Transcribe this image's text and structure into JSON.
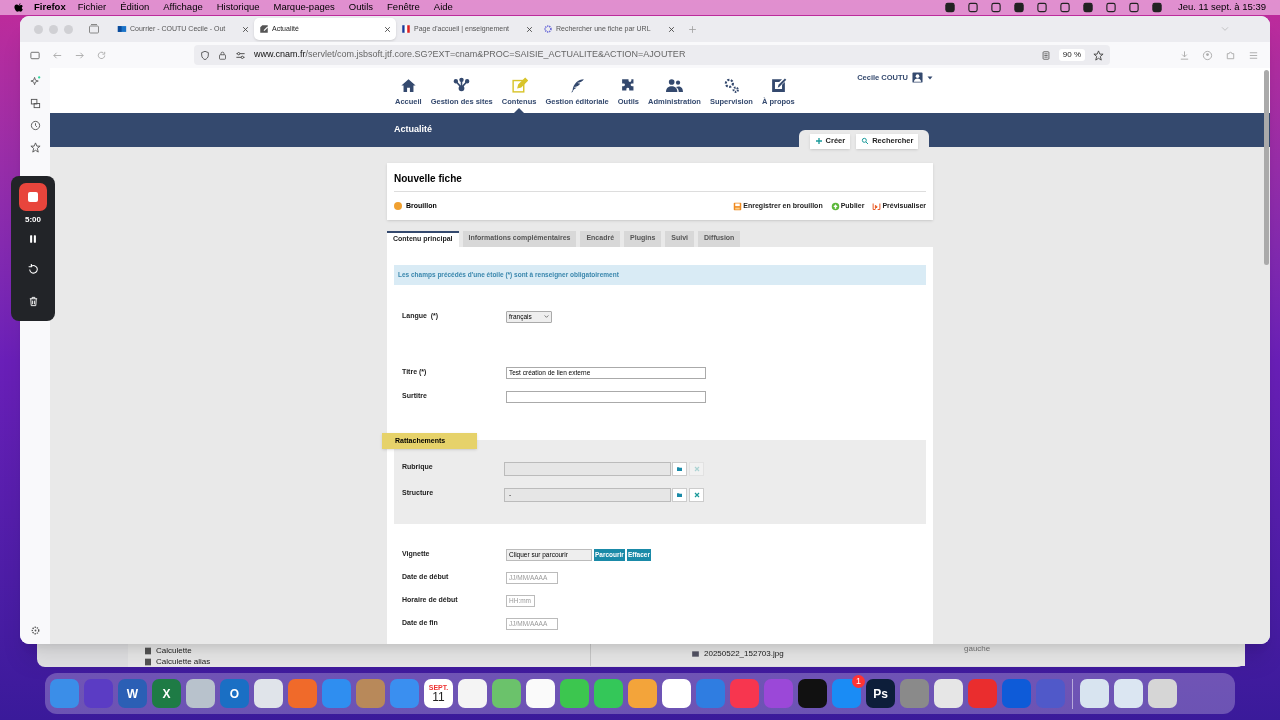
{
  "menu_bar": {
    "app": "Firefox",
    "menus": [
      "Fichier",
      "Édition",
      "Affichage",
      "Historique",
      "Marque-pages",
      "Outils",
      "Fenêtre",
      "Aide"
    ],
    "clock": "Jeu. 11 sept. à 15:39"
  },
  "tabs": [
    {
      "label": "Courrier - COUTU Cecile - Out",
      "selected": false,
      "kind": "mail"
    },
    {
      "label": "Actualité",
      "selected": true,
      "kind": "edit"
    },
    {
      "label": "Page d'accueil | enseignement",
      "selected": false,
      "kind": "flag"
    },
    {
      "label": "Rechercher une fiche par URL",
      "selected": false,
      "kind": "gear"
    }
  ],
  "address_bar": {
    "host": "www.cnam.fr",
    "path": "/servlet/com.jsbsoft.jtf.core.SG?EXT=cnam&PROC=SAISIE_ACTUALITE&ACTION=AJOUTER",
    "zoom": "90 %"
  },
  "recorder": {
    "time": "5:00"
  },
  "site_nav": {
    "items": [
      {
        "label": "Accueil",
        "kind": "home",
        "selected": false
      },
      {
        "label": "Gestion des sites",
        "kind": "network",
        "selected": false
      },
      {
        "label": "Contenus",
        "kind": "edit",
        "selected": true
      },
      {
        "label": "Gestion éditoriale",
        "kind": "feather",
        "selected": false
      },
      {
        "label": "Outils",
        "kind": "puzzle",
        "selected": false
      },
      {
        "label": "Administration",
        "kind": "users",
        "selected": false
      },
      {
        "label": "Supervision",
        "kind": "gears",
        "selected": false
      },
      {
        "label": "À propos",
        "kind": "about",
        "selected": false
      }
    ],
    "user": "Cecile COUTU"
  },
  "page_title": "Actualité",
  "page_actions": [
    {
      "label": "Créer",
      "kind": "plus"
    },
    {
      "label": "Rechercher",
      "kind": "search"
    }
  ],
  "card": {
    "title": "Nouvelle fiche",
    "status": {
      "label": "Brouillon",
      "color": "#f0a030"
    },
    "actions": [
      {
        "label": "Enregistrer en brouillon",
        "kind": "save"
      },
      {
        "label": "Publier",
        "kind": "publish"
      },
      {
        "label": "Prévisualiser",
        "kind": "preview"
      }
    ]
  },
  "form_tabs": [
    {
      "label": "Contenu principal",
      "selected": true
    },
    {
      "label": "Informations complémentaires",
      "selected": false
    },
    {
      "label": "Encadré",
      "selected": false
    },
    {
      "label": "Plugins",
      "selected": false
    },
    {
      "label": "Suivi",
      "selected": false
    },
    {
      "label": "Diffusion",
      "selected": false
    }
  ],
  "notice": "Les champs précédés d'une étoile (*) sont à renseigner obligatoirement",
  "fields": [
    {
      "label": "Langue  (*)",
      "kind": "select",
      "value": "français"
    },
    {
      "label": "Titre (*)",
      "kind": "text",
      "value": "Test création de lien externe"
    },
    {
      "label": "Surtitre",
      "kind": "text"
    }
  ],
  "rattachements": {
    "title": "Rattachements",
    "fields": [
      {
        "label": "Rubrique",
        "clear_enabled": false
      },
      {
        "label": "Structure",
        "value": "-",
        "clear_enabled": true
      }
    ]
  },
  "more_fields": [
    {
      "label": "Vignette",
      "kind": "file",
      "value": "Cliquer sur parcourir",
      "buttons": [
        "Parcourir",
        "Effacer"
      ]
    },
    {
      "label": "Date de début",
      "kind": "text",
      "placeholder": "JJ/MM/AAAA"
    },
    {
      "label": "Horaire de début",
      "kind": "short",
      "placeholder": "HH:mm"
    },
    {
      "label": "Date de fin",
      "kind": "text",
      "placeholder": "JJ/MM/AAAA"
    }
  ],
  "background_windows": {
    "finder_items": [
      "Calculette",
      "Calculette alias"
    ],
    "file": "20250522_152703.jpg",
    "column_text": "gauche"
  },
  "dock": [
    {
      "kind": "plain",
      "color": "#3b8ee8"
    },
    {
      "kind": "plain",
      "color": "#5b3cc4"
    },
    {
      "kind": "letter",
      "color": "#2b5fb5",
      "glyph": "W"
    },
    {
      "kind": "letter",
      "color": "#1e7b45",
      "glyph": "X"
    },
    {
      "kind": "plain",
      "color": "#b8c2cc"
    },
    {
      "kind": "letter",
      "color": "#1a6fc4",
      "glyph": "O"
    },
    {
      "kind": "plain",
      "color": "#e0e4ea"
    },
    {
      "kind": "plain",
      "color": "#f06a2a"
    },
    {
      "kind": "plain",
      "color": "#2f8ef0"
    },
    {
      "kind": "plain",
      "color": "#b8895a"
    },
    {
      "kind": "plain",
      "color": "#3a8ff0"
    },
    {
      "kind": "calendar",
      "color": "#ffffff",
      "month": "SEPT.",
      "day": "11"
    },
    {
      "kind": "plain",
      "color": "#f4f4f4"
    },
    {
      "kind": "plain",
      "color": "#6bc26b"
    },
    {
      "kind": "plain",
      "color": "#fafafa"
    },
    {
      "kind": "plain",
      "color": "#3cc64f"
    },
    {
      "kind": "plain",
      "color": "#34c759"
    },
    {
      "kind": "plain",
      "color": "#f3a43a"
    },
    {
      "kind": "plain",
      "color": "#ffffff"
    },
    {
      "kind": "plain",
      "color": "#2f7de1"
    },
    {
      "kind": "plain",
      "color": "#f7364f"
    },
    {
      "kind": "plain",
      "color": "#9b48d8"
    },
    {
      "kind": "plain",
      "color": "#111111"
    },
    {
      "kind": "badge",
      "color": "#1a8cf5",
      "badge": "1"
    },
    {
      "kind": "letter",
      "color": "#0d1e3a",
      "glyph": "Ps"
    },
    {
      "kind": "plain",
      "color": "#8a8a8a"
    },
    {
      "kind": "plain",
      "color": "#e6e6e6"
    },
    {
      "kind": "plain",
      "color": "#ea2d2e"
    },
    {
      "kind": "plain",
      "color": "#0e5bd8"
    },
    {
      "kind": "plain",
      "color": "#5059c9"
    },
    {
      "kind": "plain",
      "color": "#d8e4f0"
    },
    {
      "kind": "plain",
      "color": "#dbe6f2"
    },
    {
      "kind": "plain",
      "color": "#d6d6d6"
    }
  ]
}
